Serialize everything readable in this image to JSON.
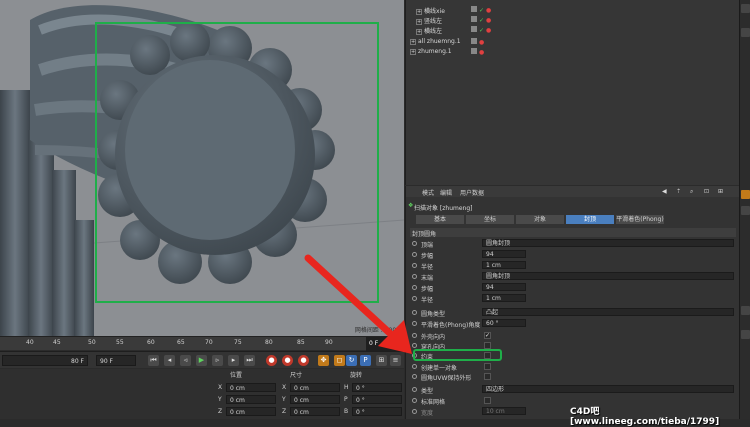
{
  "viewport": {
    "grid_readout": "网格间距 : 1000",
    "colors": {
      "background": "#8c8f93",
      "object": "#5b6670",
      "highlight": "#1fae49"
    }
  },
  "timeline": {
    "ticks": [
      "40",
      "45",
      "50",
      "55",
      "60",
      "65",
      "70",
      "75",
      "80",
      "85",
      "90"
    ],
    "playhead": "0 F"
  },
  "transport": {
    "start_frame": "80 F",
    "end_frame": "90 F"
  },
  "coords": {
    "headers": [
      "位置",
      "尺寸",
      "旋转"
    ],
    "rows": [
      {
        "axis": "X",
        "position": "0 cm",
        "size_axis": "X",
        "size": "0 cm",
        "rot_axis": "H",
        "rotation": "0 °"
      },
      {
        "axis": "Y",
        "position": "0 cm",
        "size_axis": "Y",
        "size": "0 cm",
        "rot_axis": "P",
        "rotation": "0 °"
      },
      {
        "axis": "Z",
        "position": "0 cm",
        "size_axis": "Z",
        "size": "0 cm",
        "rot_axis": "B",
        "rotation": "0 °"
      }
    ]
  },
  "objects": [
    {
      "name": "横线xie"
    },
    {
      "name": "竖线左"
    },
    {
      "name": "横线左"
    },
    {
      "name": "all zhuemng.1"
    },
    {
      "name": "zhumeng.1"
    }
  ],
  "attr": {
    "menus": [
      "模式",
      "编辑",
      "用户数据"
    ],
    "title": "扫描对象 [zhumeng]",
    "tabs": [
      "基本",
      "坐标",
      "对象",
      "封顶",
      "平滑着色(Phong)"
    ],
    "active_tab": "封顶",
    "section": "封顶圆角",
    "rows": [
      {
        "label": "顶端",
        "value": "圆角封顶",
        "kind": "wide"
      },
      {
        "label": "步幅",
        "value": "94",
        "kind": "short"
      },
      {
        "label": "半径",
        "value": "1 cm",
        "kind": "short"
      },
      {
        "label": "末端",
        "value": "圆角封顶",
        "kind": "wide"
      },
      {
        "label": "步幅",
        "value": "94",
        "kind": "short"
      },
      {
        "label": "半径",
        "value": "1 cm",
        "kind": "short"
      },
      {
        "label": "圆角类型",
        "value": "凸起",
        "kind": "wide"
      },
      {
        "label": "平滑着色(Phong)角度",
        "value": "60 °",
        "kind": "short"
      },
      {
        "label": "外壳向内",
        "value": "✓",
        "kind": "check"
      },
      {
        "label": "穿孔向内",
        "value": "",
        "kind": "check"
      },
      {
        "label": "约束",
        "value": "",
        "kind": "check"
      },
      {
        "label": "创建单一对象",
        "value": "",
        "kind": "check"
      },
      {
        "label": "圆角UVW保持外形",
        "value": "",
        "kind": "check"
      },
      {
        "label": "类型",
        "value": "四边形",
        "kind": "wide"
      },
      {
        "label": "标准网格",
        "value": "",
        "kind": "check"
      },
      {
        "label": "宽度",
        "value": "10 cm",
        "kind": "short-dis"
      }
    ]
  },
  "watermark": "C4D吧 [www.lineeg.com/tieba/1799]"
}
